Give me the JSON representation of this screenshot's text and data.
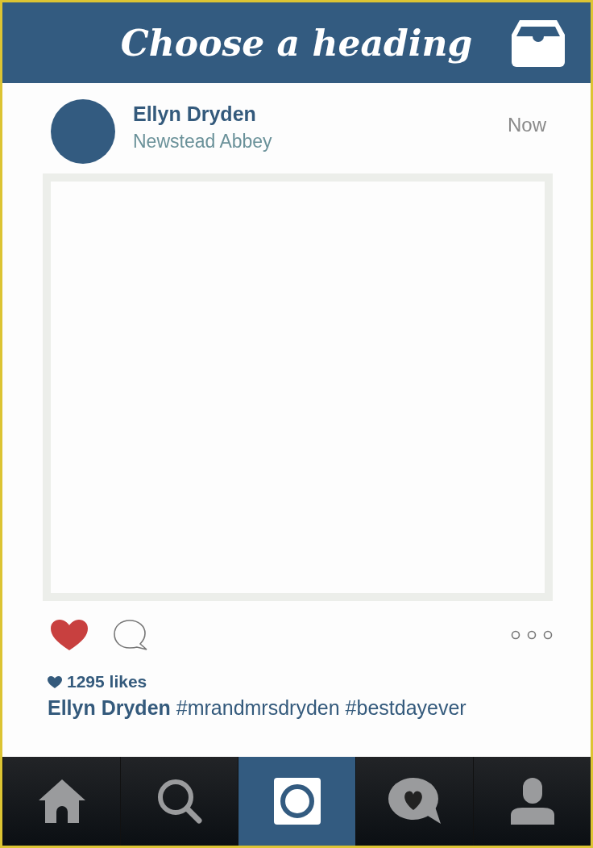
{
  "header": {
    "title": "Choose a heading"
  },
  "post": {
    "author": "Ellyn Dryden",
    "location": "Newstead Abbey",
    "time": "Now",
    "liked": true,
    "likes": "1295 likes",
    "caption": "**Ellyn Dryden** #mrandmrsdryden #bestdayever"
  },
  "nav": [
    {
      "kind": "home",
      "selected": false
    },
    {
      "kind": "search",
      "selected": false
    },
    {
      "kind": "camera",
      "selected": true
    },
    {
      "kind": "activity",
      "selected": false
    },
    {
      "kind": "profile",
      "selected": false
    }
  ]
}
